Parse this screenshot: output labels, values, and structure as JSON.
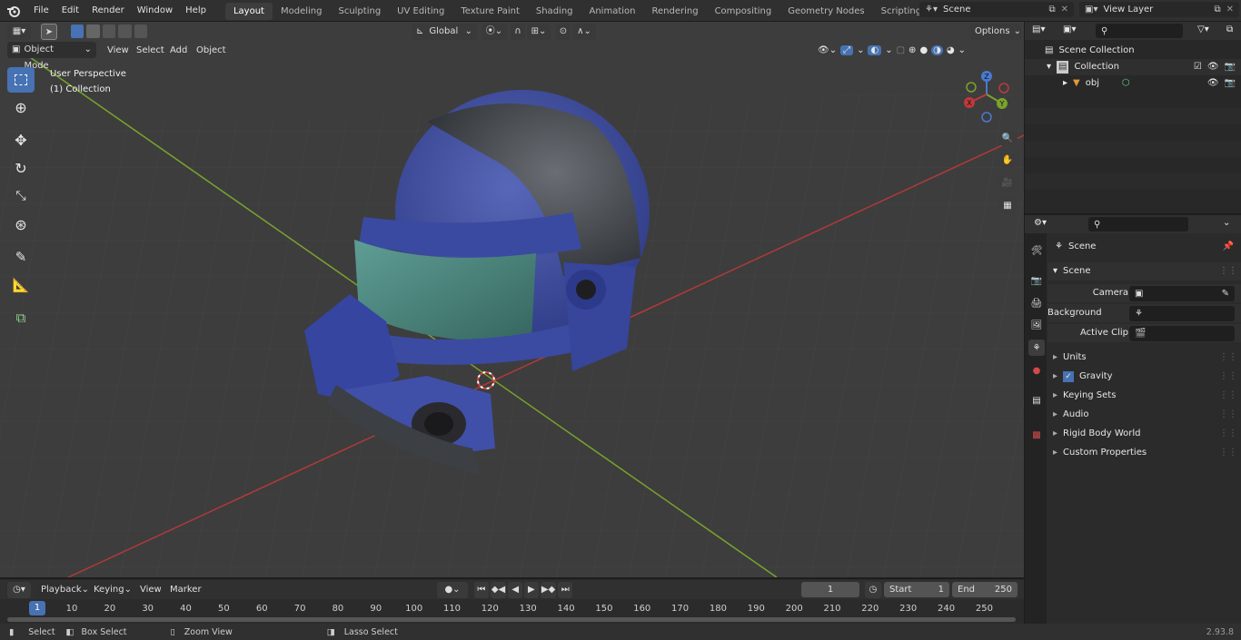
{
  "topbar": {
    "menus": [
      "File",
      "Edit",
      "Render",
      "Window",
      "Help"
    ],
    "workspaces": [
      "Layout",
      "Modeling",
      "Sculpting",
      "UV Editing",
      "Texture Paint",
      "Shading",
      "Animation",
      "Rendering",
      "Compositing",
      "Geometry Nodes",
      "Scripting"
    ],
    "active_workspace": "Layout",
    "add_tab": "+",
    "scene_name": "Scene",
    "view_layer": "View Layer"
  },
  "header": {
    "mode": "Object Mode",
    "menus": [
      "View",
      "Select",
      "Add",
      "Object"
    ],
    "orientation": "Global",
    "options": "Options"
  },
  "viewport": {
    "title": "User Perspective",
    "subtitle": "(1) Collection",
    "gizmo": {
      "x": "X",
      "y": "Y",
      "z": "Z"
    }
  },
  "outliner": {
    "search_placeholder": "",
    "rows": [
      {
        "label": "Scene Collection"
      },
      {
        "label": "Collection"
      },
      {
        "label": "obj"
      }
    ]
  },
  "properties": {
    "context": "Scene",
    "panel_title": "Scene",
    "fields": [
      {
        "label": "Camera",
        "value": ""
      },
      {
        "label": "Background Scene",
        "value": ""
      },
      {
        "label": "Active Clip",
        "value": ""
      }
    ],
    "sections": [
      "Units",
      "Gravity",
      "Keying Sets",
      "Audio",
      "Rigid Body World",
      "Custom Properties"
    ]
  },
  "timeline": {
    "menus": [
      "Playback",
      "Keying",
      "View",
      "Marker"
    ],
    "current_frame": "1",
    "start_label": "Start",
    "start_value": "1",
    "end_label": "End",
    "end_value": "250",
    "ticks": [
      "1",
      "10",
      "20",
      "30",
      "40",
      "50",
      "60",
      "70",
      "80",
      "90",
      "100",
      "110",
      "120",
      "130",
      "140",
      "150",
      "160",
      "170",
      "180",
      "190",
      "200",
      "210",
      "220",
      "230",
      "240",
      "250"
    ]
  },
  "statusbar": {
    "items": [
      "Select",
      "Box Select",
      "Zoom View",
      "Lasso Select"
    ],
    "version": "2.93.8"
  },
  "colors": {
    "accent": "#4772b3",
    "x_axis": "#b03a3a",
    "y_axis": "#7aa32c",
    "helmet": "#3f4fa3",
    "visor": "#4f8c84"
  }
}
